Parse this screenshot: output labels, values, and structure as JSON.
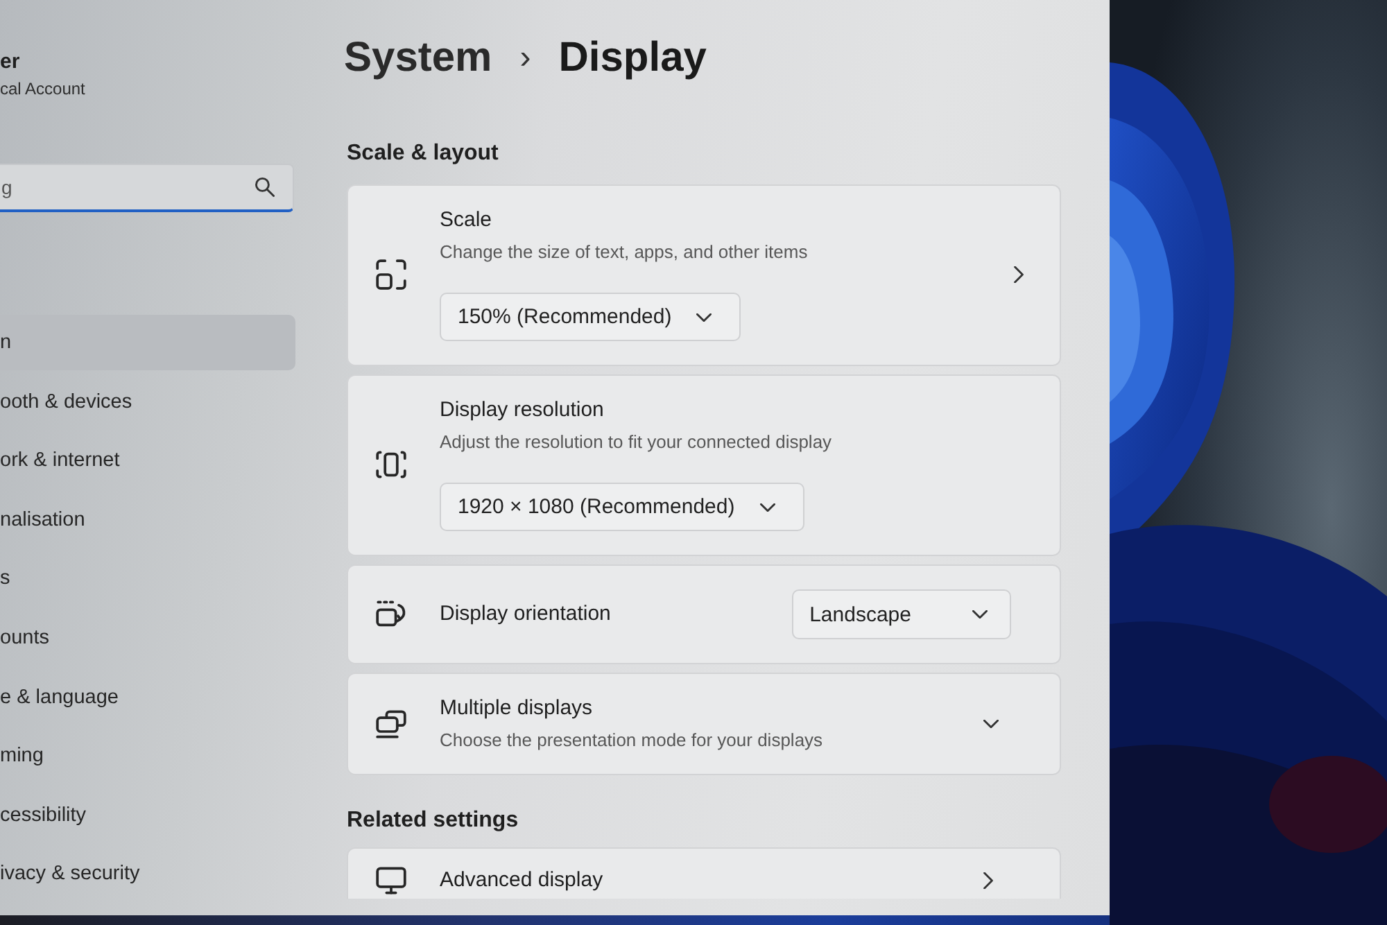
{
  "account": {
    "name": "er",
    "type": "cal Account"
  },
  "search": {
    "placeholder": "g"
  },
  "nav": [
    {
      "label": "n",
      "selected": true
    },
    {
      "label": "ooth & devices",
      "selected": false
    },
    {
      "label": "ork & internet",
      "selected": false
    },
    {
      "label": "nalisation",
      "selected": false
    },
    {
      "label": "s",
      "selected": false
    },
    {
      "label": "ounts",
      "selected": false
    },
    {
      "label": "e & language",
      "selected": false
    },
    {
      "label": "ming",
      "selected": false
    },
    {
      "label": "cessibility",
      "selected": false
    },
    {
      "label": "ivacy & security",
      "selected": false
    }
  ],
  "breadcrumb": {
    "parent": "System",
    "separator": "›",
    "current": "Display"
  },
  "sections": [
    {
      "title": "Scale & layout",
      "cards": [
        {
          "kind": "stacked_link",
          "title": "Scale",
          "description": "Change the size of text, apps, and other items",
          "value": "150% (Recommended)"
        },
        {
          "kind": "stacked",
          "title": "Display resolution",
          "description": "Adjust the resolution to fit your connected display",
          "value": "1920 × 1080 (Recommended)"
        },
        {
          "kind": "inline",
          "title": "Display orientation",
          "value": "Landscape"
        },
        {
          "kind": "expander",
          "title": "Multiple displays",
          "description": "Choose the presentation mode for your displays",
          "expanded": false
        }
      ]
    },
    {
      "title": "Related settings",
      "cards": [
        {
          "kind": "link",
          "title": "Advanced display"
        }
      ]
    }
  ]
}
